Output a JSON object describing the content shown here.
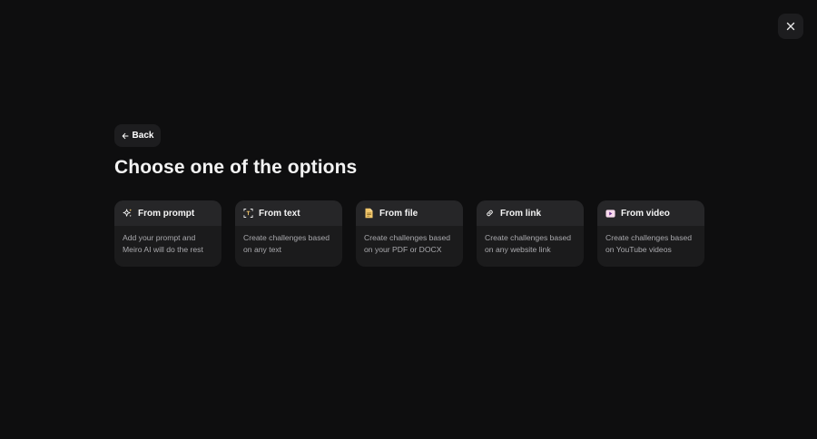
{
  "header": {
    "close_icon": "close-icon"
  },
  "back": {
    "label": "Back",
    "icon": "arrow-left-icon"
  },
  "title": "Choose one of the options",
  "options": [
    {
      "title": "From prompt",
      "icon": "sparkles-icon",
      "desc_line1": "Add your prompt and",
      "desc_line2": "Meiro AI will do the rest"
    },
    {
      "title": "From text",
      "icon": "text-scan-icon",
      "desc_line1": "Create challenges based",
      "desc_line2": "on any text"
    },
    {
      "title": "From file",
      "icon": "file-icon",
      "desc_line1": "Create challenges based",
      "desc_line2": "on your PDF or DOCX"
    },
    {
      "title": "From link",
      "icon": "link-icon",
      "desc_line1": "Create challenges based",
      "desc_line2": "on any website link"
    },
    {
      "title": "From video",
      "icon": "video-play-icon",
      "desc_line1": "Create challenges based",
      "desc_line2": "on YouTube videos"
    }
  ],
  "colors": {
    "background": "#0e0e0f",
    "card": "#1b1b1c",
    "card_header": "#262628",
    "icon_accent": "#f2c76b",
    "video_icon_bg": "#f7d9ec",
    "video_icon_play": "#6a2e8f"
  }
}
